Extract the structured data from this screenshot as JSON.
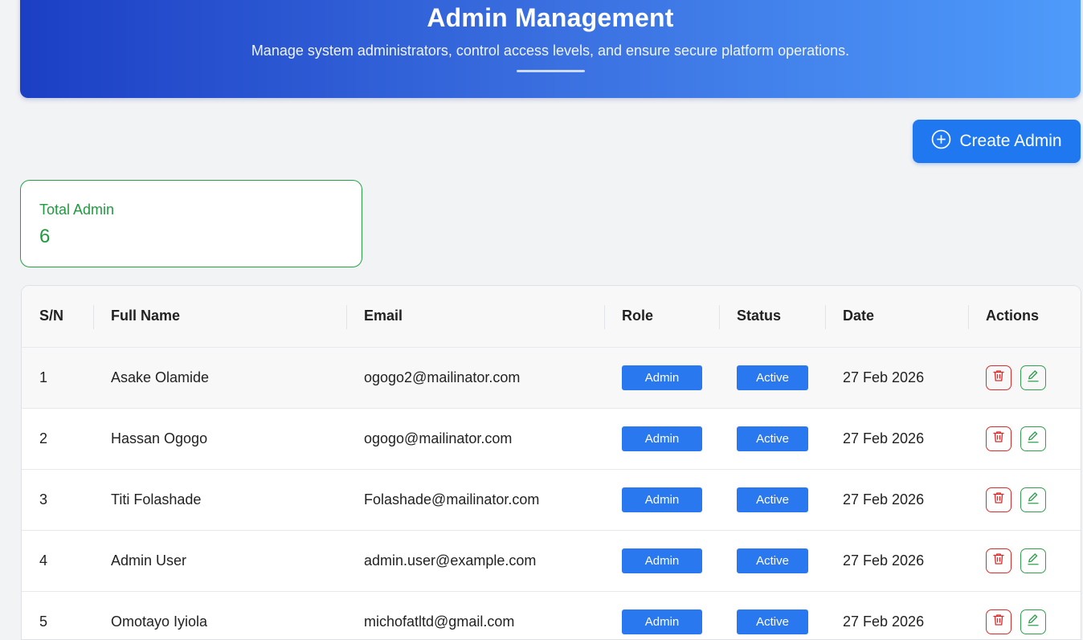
{
  "header": {
    "title": "Admin Management",
    "subtitle": "Manage system administrators, control access levels, and ensure secure platform operations."
  },
  "create_button": {
    "label": "Create Admin",
    "icon": "plus-circle-icon"
  },
  "stats": {
    "label": "Total Admin",
    "value": "6"
  },
  "table": {
    "columns": [
      "S/N",
      "Full Name",
      "Email",
      "Role",
      "Status",
      "Date",
      "Actions"
    ],
    "rows": [
      {
        "sn": "1",
        "name": "Asake Olamide",
        "email": "ogogo2@mailinator.com",
        "role": "Admin",
        "status": "Active",
        "date": "27 Feb 2026"
      },
      {
        "sn": "2",
        "name": "Hassan Ogogo",
        "email": "ogogo@mailinator.com",
        "role": "Admin",
        "status": "Active",
        "date": "27 Feb 2026"
      },
      {
        "sn": "3",
        "name": "Titi Folashade",
        "email": "Folashade@mailinator.com",
        "role": "Admin",
        "status": "Active",
        "date": "27 Feb 2026"
      },
      {
        "sn": "4",
        "name": "Admin User",
        "email": "admin.user@example.com",
        "role": "Admin",
        "status": "Active",
        "date": "27 Feb 2026"
      },
      {
        "sn": "5",
        "name": "Omotayo Iyiola",
        "email": "michofatltd@gmail.com",
        "role": "Admin",
        "status": "Active",
        "date": "27 Feb 2026"
      }
    ]
  },
  "colors": {
    "primary": "#1f78f0",
    "success": "#23a244",
    "danger": "#dc2b2b",
    "hero_gradient_start": "#1c3fc4",
    "hero_gradient_end": "#4e9bfb"
  }
}
